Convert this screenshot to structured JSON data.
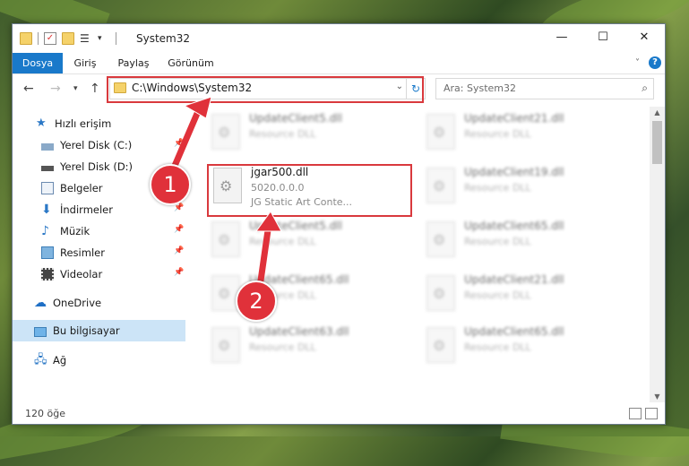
{
  "window": {
    "title": "System32"
  },
  "ribbon": {
    "tabs": [
      "Dosya",
      "Giriş",
      "Paylaş",
      "Görünüm"
    ]
  },
  "navigation": {
    "address": "C:\\Windows\\System32",
    "search_placeholder": "Ara: System32"
  },
  "sidebar": {
    "items": [
      {
        "label": "Hızlı erişim",
        "icon": "star-icon"
      },
      {
        "label": "Yerel Disk (C:)",
        "icon": "drive-icon"
      },
      {
        "label": "Yerel Disk (D:)",
        "icon": "drive-icon"
      },
      {
        "label": "Belgeler",
        "icon": "documents-icon"
      },
      {
        "label": "İndirmeler",
        "icon": "download-icon"
      },
      {
        "label": "Müzik",
        "icon": "music-icon"
      },
      {
        "label": "Resimler",
        "icon": "pictures-icon"
      },
      {
        "label": "Videolar",
        "icon": "video-icon"
      },
      {
        "label": "OneDrive",
        "icon": "cloud-icon"
      },
      {
        "label": "Bu bilgisayar",
        "icon": "computer-icon"
      },
      {
        "label": "Ağ",
        "icon": "network-icon"
      }
    ]
  },
  "files": {
    "left": [
      {
        "name": "UpdateClient5.dll",
        "desc": "Resource DLL"
      },
      {
        "name": "jgar500.dll",
        "version": "5020.0.0.0",
        "desc": "JG Static Art Conte..."
      },
      {
        "name": "UpdateClient5.dll",
        "desc": "Resource DLL"
      },
      {
        "name": "UpdateClient65.dll",
        "desc": "Resource DLL"
      },
      {
        "name": "UpdateClient63.dll",
        "desc": "Resource DLL"
      }
    ],
    "right": [
      {
        "name": "UpdateClient21.dll",
        "desc": "Resource DLL"
      },
      {
        "name": "UpdateClient19.dll",
        "desc": "Resource DLL"
      },
      {
        "name": "UpdateClient65.dll",
        "desc": "Resource DLL"
      },
      {
        "name": "UpdateClient21.dll",
        "desc": "Resource DLL"
      },
      {
        "name": "UpdateClient65.dll",
        "desc": "Resource DLL"
      }
    ]
  },
  "status": {
    "count": "120 öğe"
  },
  "annotations": {
    "step1": "1",
    "step2": "2",
    "color": "#e0313a"
  }
}
